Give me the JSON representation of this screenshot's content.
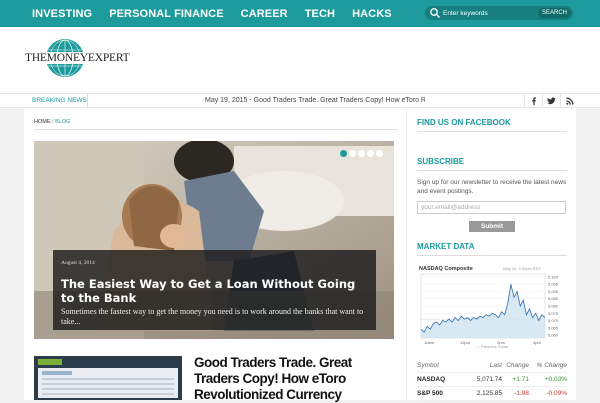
{
  "nav": {
    "items": [
      "INVESTING",
      "PERSONAL FINANCE",
      "CAREER",
      "TECH",
      "HACKS"
    ],
    "search_placeholder": "Enter keywords",
    "search_button": "SEARCH"
  },
  "logo": {
    "text": "THEMONEYEXPERT"
  },
  "breaking": {
    "label": "BREAKING NEWS",
    "headline": "May 19, 2015 - Good Traders Trade. Great Traders Copy! How eToro Revolutionized Currency Trading"
  },
  "breadcrumb": {
    "home": "HOME",
    "sep": "/",
    "current": "BLOG"
  },
  "slider": {
    "slides": 5,
    "active_slide": 1,
    "date": "August 4, 2014",
    "title": "The Easiest Way to Get a Loan Without Going to the Bank",
    "excerpt": "Sometimes the fastest way to get the money you need is to work around the banks that want to take..."
  },
  "post2": {
    "title": "Good Traders Trade. Great Traders Copy! How eToro Revolutionized Currency"
  },
  "sidebar": {
    "facebook_title": "FIND US ON FACEBOOK",
    "subscribe_title": "SUBSCRIBE",
    "subscribe_text": "Sign up for our newsletter to receive the latest news and event postings.",
    "email_placeholder": "your.email@address",
    "submit_label": "Submit",
    "market_title": "MARKET DATA"
  },
  "chart_data": {
    "type": "line",
    "title": "NASDAQ Composite",
    "subtitle": "May 20, 4:00pm EDT",
    "x_ticks": [
      "10am",
      "12pm",
      "2pm",
      "4pm"
    ],
    "y_ticks": [
      5060,
      5065,
      5070,
      5075,
      5080,
      5085,
      5090,
      5095,
      5100
    ],
    "ylim": [
      5058,
      5102
    ],
    "footer": "— Previous Close",
    "previous_close": 5071,
    "series": [
      {
        "values": [
          5064,
          5062,
          5066,
          5064,
          5068,
          5069,
          5067,
          5070,
          5069,
          5071,
          5069,
          5072,
          5070,
          5073,
          5071,
          5072,
          5070,
          5072,
          5071,
          5073,
          5072,
          5074,
          5073,
          5075,
          5074,
          5072,
          5076,
          5074,
          5082,
          5095,
          5086,
          5090,
          5080,
          5084,
          5074,
          5078,
          5072,
          5075,
          5070,
          5074,
          5072
        ]
      }
    ]
  },
  "market_table": {
    "headers": [
      "Symbol",
      "Last",
      "Change",
      "% Change"
    ],
    "rows": [
      {
        "symbol": "NASDAQ",
        "last": "5,071.74",
        "change": "+1.71",
        "pct": "+0.03%",
        "dir": "up"
      },
      {
        "symbol": "S&P 500",
        "last": "2,125.85",
        "change": "-1.98",
        "pct": "-0.09%",
        "dir": "down"
      }
    ]
  }
}
